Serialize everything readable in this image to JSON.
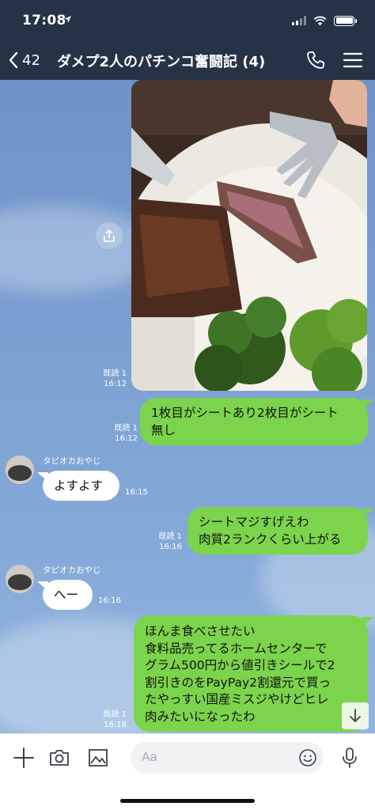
{
  "status_bar": {
    "time": "17:08"
  },
  "header": {
    "back_count": "42",
    "title": "ダメプ2人のパチンコ奮闘記 (4)"
  },
  "messages": {
    "photo": {
      "read": "既読 1",
      "time": "16:12",
      "alt": "steak-and-broccoli-photo"
    },
    "m1": {
      "read": "既読 1",
      "time": "16:12",
      "lines": [
        "1枚目がシートあり2枚目がシート",
        "無し"
      ]
    },
    "m2": {
      "sender": "タピオカおやじ",
      "text": "よすよす",
      "time": "16:15"
    },
    "m3": {
      "read": "既読 1",
      "time": "16:16",
      "lines": [
        "シートマジすげえわ",
        "肉質2ランクくらい上がる"
      ]
    },
    "m4": {
      "sender": "タピオカおやじ",
      "text": "へー",
      "time": "16:16"
    },
    "m5": {
      "read": "既読 1",
      "time": "16:18",
      "lines": [
        "ほんま食べさせたい",
        "食料品売ってるホームセンターで",
        "グラム500円から値引きシールで2",
        "割引きのをPayPay2割還元で買っ",
        "たやっすい国産ミスジやけどヒレ",
        "肉みたいになったわ"
      ]
    }
  },
  "input": {
    "placeholder": "Aa"
  },
  "icons": [
    "back-icon",
    "phone-icon",
    "menu-icon",
    "share-icon",
    "scroll-down-icon",
    "plus-icon",
    "camera-icon",
    "image-icon",
    "emoji-icon",
    "mic-icon"
  ],
  "colors": {
    "header_bg": "#263246",
    "my_bubble": "#7bd44c",
    "their_bubble": "#ffffff",
    "chat_bg": "#7ba0d2"
  }
}
